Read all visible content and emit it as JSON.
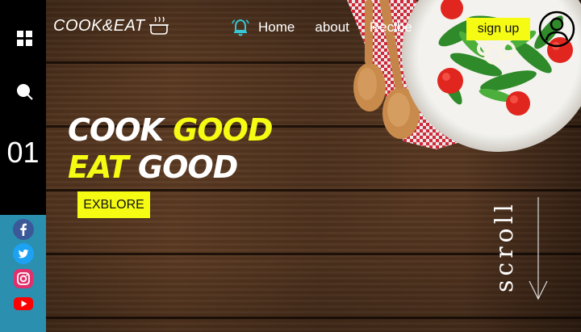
{
  "brand": {
    "logo_text": "COOK&EAT",
    "logo_icon": "cooking-pot-icon"
  },
  "nav": {
    "bell_icon": "bell-icon",
    "items": [
      {
        "label": "Home"
      },
      {
        "label": "about"
      },
      {
        "label": "Recibe"
      }
    ]
  },
  "header": {
    "signup_label": "sign up",
    "user_icon": "user-circle-icon"
  },
  "sidebar": {
    "menu_icon": "grid-menu-icon",
    "search_icon": "search-icon",
    "slide_number": "01",
    "social": [
      {
        "name": "facebook-icon",
        "color": "#3b5998"
      },
      {
        "name": "twitter-icon",
        "color": "#1da1f2"
      },
      {
        "name": "instagram-icon",
        "color": "#e1306c"
      },
      {
        "name": "youtube-icon",
        "color": "#ff0000"
      }
    ]
  },
  "hero": {
    "line1_white": "COOK",
    "line1_yellow": "GOOD",
    "line2_yellow": "EAT",
    "line2_white": "GOOD",
    "cta_label": "EXBLORE"
  },
  "scroll": {
    "label": "scroll"
  },
  "colors": {
    "accent": "#f6fb13",
    "sidebar": "#000000",
    "social_bg": "#2b8fb0"
  }
}
